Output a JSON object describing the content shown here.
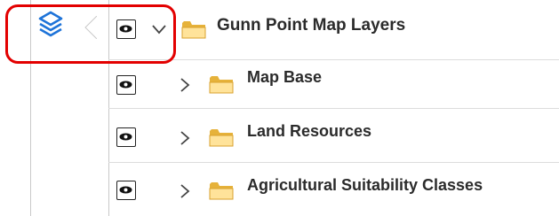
{
  "panel": {
    "active_tab_icon": "layers-icon"
  },
  "tree": {
    "root": {
      "label": "Gunn Point Map Layers",
      "expanded": true,
      "visible": true
    },
    "children": [
      {
        "label": "Map Base",
        "expanded": false,
        "visible": true
      },
      {
        "label": "Land Resources",
        "expanded": false,
        "visible": true
      },
      {
        "label": "Agricultural Suitability Classes",
        "expanded": false,
        "visible": true
      }
    ]
  },
  "colors": {
    "highlight": "#e30000",
    "layers_icon": "#1e73d8",
    "folder_light": "#ffe39a",
    "folder_dark": "#e6b23a"
  }
}
